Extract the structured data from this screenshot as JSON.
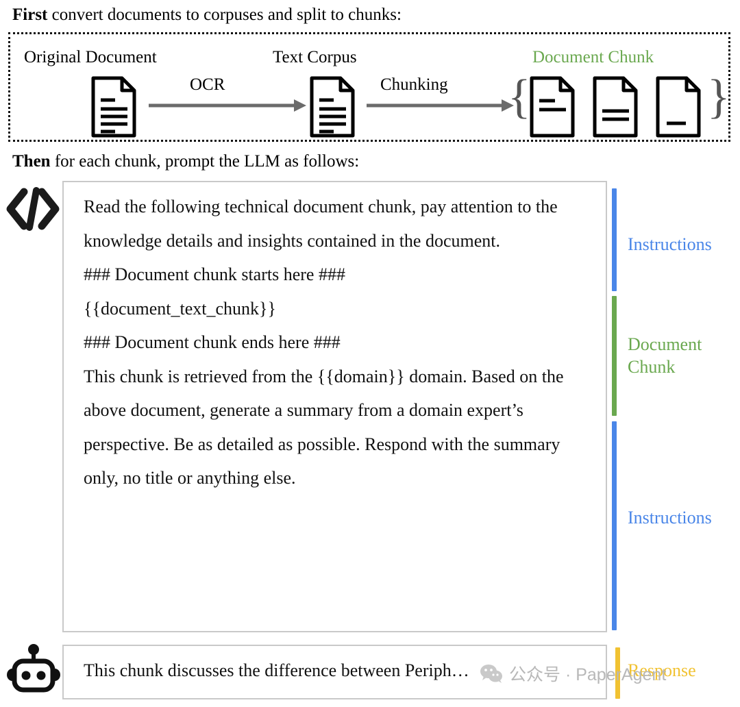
{
  "captions": {
    "first": {
      "lead": "First",
      "rest": " convert documents to corpuses and split to chunks:"
    },
    "then": {
      "lead": "Then",
      "rest": " for each chunk, prompt the LLM as follows:"
    }
  },
  "pipeline": {
    "stages": [
      {
        "label": "Original Document",
        "icon": "document-icon"
      },
      {
        "label": "Text Corpus",
        "icon": "document-icon"
      },
      {
        "label": "Document Chunk",
        "icon": "document-icon",
        "color": "#6aa84f"
      }
    ],
    "arrows": [
      {
        "label": "OCR",
        "icon": "arrow-right-icon"
      },
      {
        "label": "Chunking",
        "icon": "arrow-right-icon"
      }
    ],
    "brace_left": "{",
    "brace_right": "}"
  },
  "prompt": {
    "icon": "code-icon",
    "lines": [
      "Read the following technical document chunk, pay attention to the knowledge details and insights contained in the document.",
      "### Document chunk starts here ###",
      "{{document_text_chunk}}",
      "### Document chunk ends here ###",
      "This chunk is retrieved from the {{domain}} domain. Based on the above document, generate a summary from a domain expert’s perspective. Be as detailed as possible. Respond with the summary only, no title or anything else."
    ]
  },
  "annotations": [
    {
      "label": "Instructions",
      "color": "#4a86e8"
    },
    {
      "label": "Document\nChunk",
      "color": "#6aa84f"
    },
    {
      "label": "Instructions",
      "color": "#4a86e8"
    },
    {
      "label": "Response",
      "color": "#f1c232"
    }
  ],
  "response": {
    "icon": "robot-icon",
    "text": "This chunk discusses the difference between Periph…"
  },
  "watermark": {
    "logo": "wechat-icon",
    "text": "公众号 · PaperAgent"
  }
}
